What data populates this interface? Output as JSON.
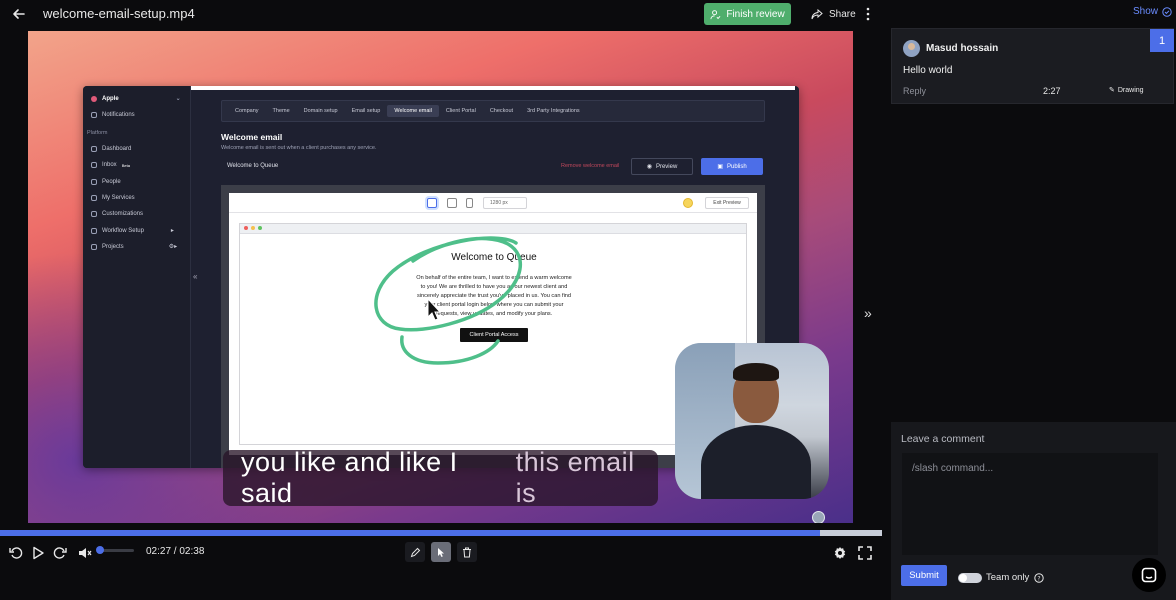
{
  "header": {
    "file_title": "welcome-email-setup.mp4",
    "finish_review_label": "Finish review",
    "share_label": "Share"
  },
  "video": {
    "app": {
      "brand": "Apple",
      "sidebar": {
        "notifications": "Notifications",
        "section_platform": "Platform",
        "items": [
          {
            "label": "Dashboard"
          },
          {
            "label": "Inbox",
            "badge": "Beta"
          },
          {
            "label": "People"
          },
          {
            "label": "My Services"
          },
          {
            "label": "Customizations"
          },
          {
            "label": "Workflow Setup"
          },
          {
            "label": "Projects"
          }
        ]
      },
      "tabs": [
        "Company",
        "Theme",
        "Domain setup",
        "Email setup",
        "Welcome email",
        "Client Portal",
        "Checkout",
        "3rd Party Integrations"
      ],
      "active_tab": "Welcome email",
      "page_title": "Welcome email",
      "page_subtitle": "Welcome email is sent out when a client purchases any service.",
      "subject": "Welcome to Queue",
      "remove_label": "Remove welcome email",
      "preview_label": "Preview",
      "publish_label": "Publish",
      "width_select": "1280 px",
      "exit_preview": "Exit Preview",
      "email": {
        "title": "Welcome to Queue",
        "body": "On behalf of the entire team, I want to extend a warm welcome to you! We are thrilled to have you as our newest client and sincerely appreciate the trust you've placed in us. You can find your client portal login below where you can submit your requests, view updates, and modify your plans.",
        "cta": "Client Portal Access"
      }
    },
    "caption_spoken": "you like and like I said",
    "caption_upcoming": "this email is"
  },
  "player": {
    "current_time": "02:27",
    "duration": "02:38",
    "time_display": "02:27 / 02:38",
    "progress_fraction": 0.93,
    "volume_fraction": 0.05
  },
  "panel": {
    "show_label": "Show",
    "comments": [
      {
        "author": "Masud hossain",
        "number": "1",
        "text": "Hello world",
        "reply_label": "Reply",
        "time": "2:27",
        "tag": "Drawing"
      }
    ],
    "compose": {
      "label": "Leave a comment",
      "placeholder": "/slash command...",
      "submit_label": "Submit",
      "team_only_label": "Team only"
    }
  },
  "colors": {
    "accent": "#4c6ee8",
    "finish_green": "#4fae6c",
    "drawing_green": "#4fbf8a"
  }
}
